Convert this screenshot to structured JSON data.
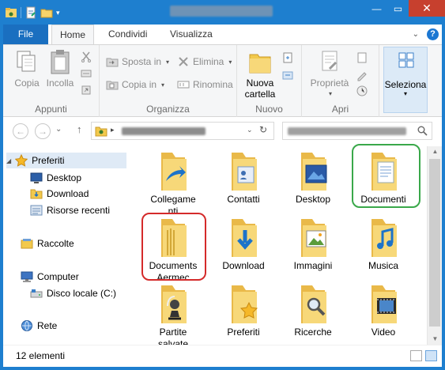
{
  "ribbon_tabs": {
    "file": "File",
    "home": "Home",
    "share": "Condividi",
    "view": "Visualizza"
  },
  "ribbon": {
    "clipboard": {
      "copy": "Copia",
      "paste": "Incolla",
      "group": "Appunti"
    },
    "organize": {
      "move_to": "Sposta in",
      "copy_to": "Copia in",
      "delete": "Elimina",
      "rename": "Rinomina",
      "group": "Organizza"
    },
    "new": {
      "new_folder_line1": "Nuova",
      "new_folder_line2": "cartella",
      "group": "Nuovo"
    },
    "open": {
      "properties": "Proprietà",
      "group": "Apri"
    },
    "select": {
      "label": "Seleziona"
    }
  },
  "nav_pane": {
    "favorites": "Preferiti",
    "desktop": "Desktop",
    "download": "Download",
    "recent": "Risorse recenti",
    "libraries": "Raccolte",
    "computer": "Computer",
    "local_disk": "Disco locale (C:)",
    "network": "Rete"
  },
  "folders": [
    {
      "line1": "Collegame",
      "line2": "nti",
      "icon": "links-folder-icon"
    },
    {
      "line1": "Contatti",
      "line2": "",
      "icon": "contacts-folder-icon"
    },
    {
      "line1": "Desktop",
      "line2": "",
      "icon": "desktop-folder-icon"
    },
    {
      "line1": "Documenti",
      "line2": "",
      "icon": "documents-folder-icon"
    },
    {
      "line1": "Documents",
      "line2": "Aermec",
      "icon": "folder-icon"
    },
    {
      "line1": "Download",
      "line2": "",
      "icon": "downloads-folder-icon"
    },
    {
      "line1": "Immagini",
      "line2": "",
      "icon": "pictures-folder-icon"
    },
    {
      "line1": "Musica",
      "line2": "",
      "icon": "music-folder-icon"
    },
    {
      "line1": "Partite",
      "line2": "salvate",
      "icon": "saved-games-folder-icon"
    },
    {
      "line1": "Preferiti",
      "line2": "",
      "icon": "favorites-folder-icon"
    },
    {
      "line1": "Ricerche",
      "line2": "",
      "icon": "searches-folder-icon"
    },
    {
      "line1": "Video",
      "line2": "",
      "icon": "videos-folder-icon"
    }
  ],
  "highlight_colors": {
    "green": "#3aa84a",
    "red": "#d42a2a"
  },
  "status": {
    "count": "12 elementi"
  }
}
